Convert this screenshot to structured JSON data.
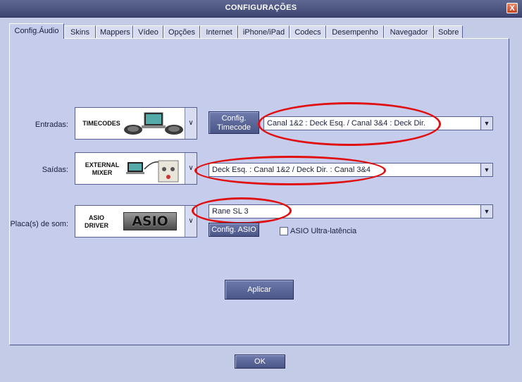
{
  "window": {
    "title": "CONFIGURAÇÕES",
    "close_glyph": "X"
  },
  "tabs": [
    {
      "label": "Config.Áudio",
      "active": true
    },
    {
      "label": "Skins"
    },
    {
      "label": "Mappers"
    },
    {
      "label": "Vídeo"
    },
    {
      "label": "Opções"
    },
    {
      "label": "Internet"
    },
    {
      "label": "iPhone/iPad"
    },
    {
      "label": "Codecs"
    },
    {
      "label": "Desempenho"
    },
    {
      "label": "Navegador"
    },
    {
      "label": "Sobre"
    }
  ],
  "entradas": {
    "label": "Entradas:",
    "selector_caption": "TIMECODES",
    "config_button": [
      "Config.",
      "Timecode"
    ],
    "value": "Canal 1&2 : Deck Esq. / Canal 3&4 : Deck Dir."
  },
  "saidas": {
    "label": "Saídas:",
    "selector_caption": [
      "EXTERNAL",
      "MIXER"
    ],
    "value": "Deck Esq. : Canal 1&2 / Deck Dir. : Canal 3&4"
  },
  "placa": {
    "label": "Placa(s) de som:",
    "selector_caption": [
      "ASIO",
      "DRIVER"
    ],
    "logo_text": "ASIO",
    "value": "Rane SL 3",
    "config_button": "Config. ASIO",
    "checkbox_label": "ASIO Ultra-latência",
    "checkbox_checked": false
  },
  "apply_button": "Aplicar",
  "ok_button": "OK",
  "colors": {
    "annotation": "#e01010",
    "title_bg": "#4b5380",
    "dialog_bg": "#c3cbe7"
  }
}
